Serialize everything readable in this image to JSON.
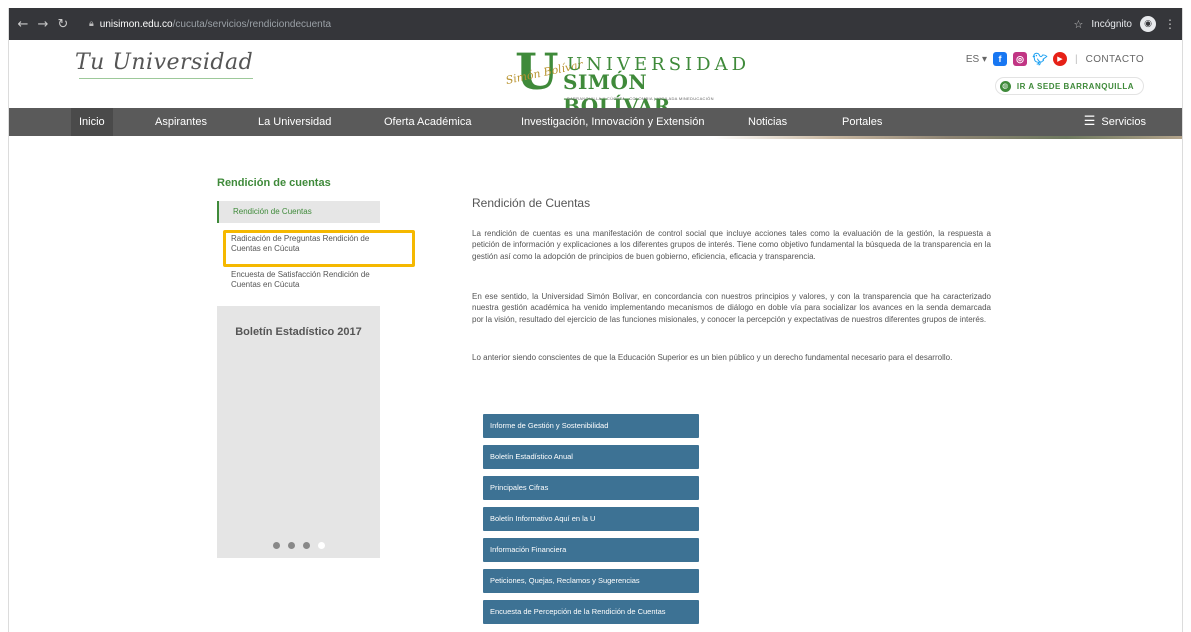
{
  "browser": {
    "url_host": "unisimon.edu.co",
    "url_path": "/cucuta/servicios/rendiciondecuenta",
    "incognito_label": "Incógnito",
    "icons": [
      "back-arrow-icon",
      "forward-arrow-icon",
      "reload-icon",
      "lock-icon",
      "star-icon",
      "incognito-icon",
      "kebab-menu-icon"
    ]
  },
  "header": {
    "tagline": "Tu Universidad",
    "logo_script": "Simón Bolívar",
    "logo_top": "UNIVERSIDAD",
    "logo_bottom": "SIMÓN BOLÍVAR",
    "logo_sub": "BARRANQUILLA Y CÚCUTA - COLOMBIA  |  VIGILADA MINEDUCACIÓN",
    "lang": "ES ▾",
    "contact": "CONTACTO",
    "sede_button": "IR A SEDE BARRANQUILLA",
    "brand_color": "#3f8a3a"
  },
  "nav": {
    "items": [
      {
        "label": "Inicio"
      },
      {
        "label": "Aspirantes"
      },
      {
        "label": "La Universidad"
      },
      {
        "label": "Oferta Académica"
      },
      {
        "label": "Investigación, Innovación y Extensión"
      },
      {
        "label": "Noticias"
      },
      {
        "label": "Portales"
      }
    ],
    "servicios": "Servicios"
  },
  "sidebar": {
    "title": "Rendición de cuentas",
    "items": [
      {
        "label": "Rendición de Cuentas"
      },
      {
        "label": "Radicación de Preguntas Rendición de Cuentas en Cúcuta"
      },
      {
        "label": "Encuesta de Satisfacción Rendición de Cuentas en Cúcuta"
      }
    ],
    "carousel_title": "Boletín Estadístico 2017"
  },
  "content": {
    "title": "Rendición de Cuentas",
    "paragraphs": [
      "La rendición de cuentas es una manifestación de control social que incluye acciones tales como la evaluación de la gestión, la respuesta a petición de información y explicaciones a los diferentes grupos de interés. Tiene como objetivo fundamental la búsqueda de la transparencia en la gestión así como la adopción de principios de buen gobierno, eficiencia, eficacia y transparencia.",
      "En ese sentido, la Universidad Simón Bolívar, en concordancia con nuestros principios y valores, y con la transparencia que ha caracterizado nuestra gestión académica ha venido implementando mecanismos de diálogo en doble vía para socializar los avances en la senda demarcada por la visión, resultado del ejercicio de las funciones misionales, y conocer la percepción y expectativas de nuestros diferentes grupos de interés.",
      "Lo anterior siendo conscientes de que la Educación Superior es un bien público y un derecho fundamental necesario para el desarrollo."
    ],
    "buttons": [
      {
        "label": "Informe de Gestión y Sostenibilidad"
      },
      {
        "label": "Boletín Estadístico Anual"
      },
      {
        "label": "Principales Cifras"
      },
      {
        "label": "Boletín Informativo Aquí en la U"
      },
      {
        "label": "Información Financiera"
      },
      {
        "label": "Peticiones, Quejas, Reclamos y Sugerencias"
      },
      {
        "label": "Encuesta de Percepción de la Rendición de Cuentas"
      }
    ],
    "button_color": "#3d7294",
    "highlight_color": "#f5b800"
  }
}
